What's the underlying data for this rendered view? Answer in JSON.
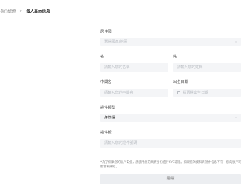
{
  "breadcrumb": {
    "parent": "身份認證",
    "separator": ">",
    "current": "個人基本信息"
  },
  "form": {
    "country": {
      "label": "居住國",
      "placeholder": "選擇國家/地區"
    },
    "first_name": {
      "label": "名",
      "placeholder": "請輸入您的名稱"
    },
    "last_name": {
      "label": "姓",
      "placeholder": "請輸入您的姓氏"
    },
    "middle_name": {
      "label": "中間名",
      "placeholder": "請輸入您的中間名"
    },
    "dob": {
      "label": "出生日期",
      "placeholder": "請選擇出生日期"
    },
    "id_type": {
      "label": "證件類型",
      "value": "身份證"
    },
    "id_number": {
      "label": "證件號",
      "placeholder": "請輸入您的證件號碼"
    }
  },
  "note": "*為了保障您的賬戶安全，請使用您的真實身份進行KYC認證。如果您的資料與證件信息不符，您的賬戶可能會被凍結。",
  "submit_label": "繼續",
  "icons": {
    "chevron": "chevron-down-icon",
    "calendar": "calendar-icon"
  }
}
